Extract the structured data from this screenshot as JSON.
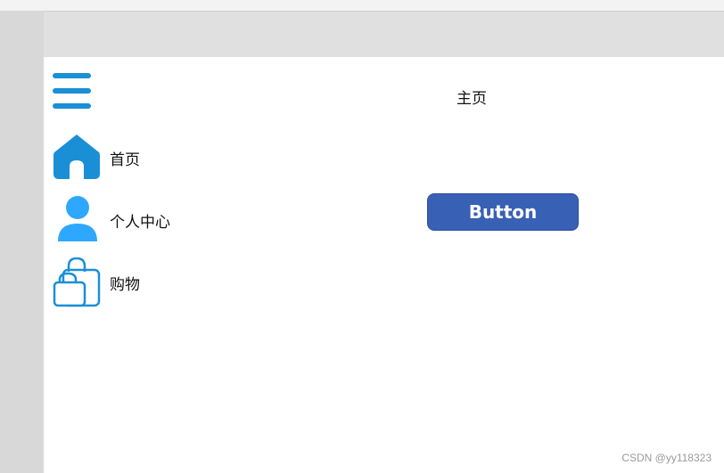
{
  "header": {
    "menu_icon": "hamburger-menu-icon",
    "title": "主页"
  },
  "sidebar": {
    "items": [
      {
        "label": "首页",
        "icon": "home-icon",
        "color": "#1a8fd6"
      },
      {
        "label": "个人中心",
        "icon": "person-icon",
        "color": "#2ea8ff"
      },
      {
        "label": "购物",
        "icon": "shopping-bag-icon",
        "color": "#1a8fd6"
      }
    ]
  },
  "main": {
    "button_label": "Button",
    "button_color": "#3860b5"
  },
  "watermark": "CSDN @yy118323"
}
